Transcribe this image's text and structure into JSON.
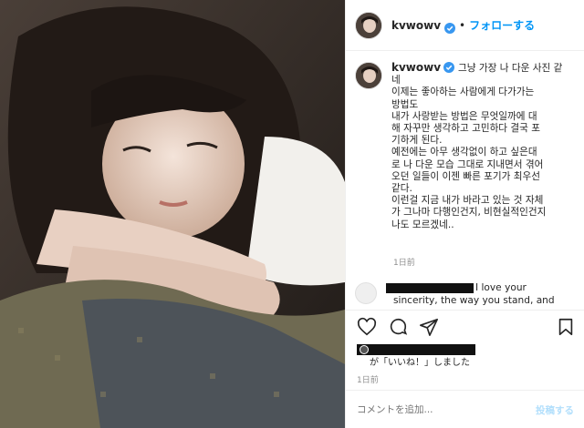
{
  "photo": {
    "alt": ""
  },
  "header": {
    "username": "kvwowv",
    "separator": "•",
    "follow_label": "フォローする"
  },
  "caption": {
    "username": "kvwowv",
    "lines": [
      "그냥 가장 나 다운 사진 같",
      "네",
      "이제는 좋아하는 사람에게 다가가는",
      "방법도",
      "내가 사랑받는 방법은 무엇일까에 대",
      "해 자꾸만 생각하고 고민하다 결국 포",
      "기하게 된다.",
      "예전에는 아무 생각없이 하고 싶은대",
      "로 나 다운 모습 그대로 지내면서 겪어",
      "오던 일들이 이젠 빠른 포기가 최우선",
      "같다.",
      "이런걸 지금 내가 바라고 있는 것 자체",
      "가 그나마 다행인건지, 비현실적인건지",
      "나도 모르겠네.."
    ],
    "time": "1日前"
  },
  "comment": {
    "line1": "I love your",
    "line2": "sincerity, the way you stand, and"
  },
  "likes": {
    "text": "が「いいね！」しました"
  },
  "post_time": "1日前",
  "add_comment": {
    "placeholder": "コメントを追加...",
    "post_label": "投稿する"
  },
  "colors": {
    "accent": "#0095f6",
    "post_disabled": "#b2dffc",
    "muted": "#8e8e8e",
    "divider": "#efefef"
  },
  "icons": [
    "verified-badge-icon",
    "heart-icon",
    "comment-icon",
    "share-icon",
    "bookmark-icon"
  ]
}
